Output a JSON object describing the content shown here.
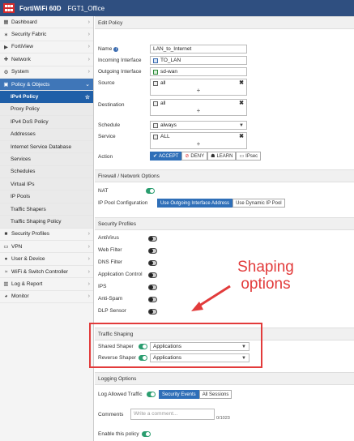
{
  "header": {
    "device": "FortiWiFi 60D",
    "hostname": "FGT1_Office"
  },
  "sidebar": {
    "items": [
      {
        "label": "Dashboard",
        "icon": "dashboard-icon",
        "glyph": "▦"
      },
      {
        "label": "Security Fabric",
        "icon": "fabric-icon",
        "glyph": "✶"
      },
      {
        "label": "FortiView",
        "icon": "fortiview-icon",
        "glyph": "▶"
      },
      {
        "label": "Network",
        "icon": "network-icon",
        "glyph": "✚"
      },
      {
        "label": "System",
        "icon": "system-icon",
        "glyph": "⚙"
      },
      {
        "label": "Policy & Objects",
        "icon": "policy-icon",
        "glyph": "▣"
      }
    ],
    "subitems": [
      "IPv4 Policy",
      "Proxy Policy",
      "IPv4 DoS Policy",
      "Addresses",
      "Internet Service Database",
      "Services",
      "Schedules",
      "Virtual IPs",
      "IP Pools",
      "Traffic Shapers",
      "Traffic Shaping Policy"
    ],
    "items2": [
      {
        "label": "Security Profiles",
        "icon": "lock-icon",
        "glyph": "■"
      },
      {
        "label": "VPN",
        "icon": "vpn-icon",
        "glyph": "▭"
      },
      {
        "label": "User & Device",
        "icon": "user-icon",
        "glyph": "●"
      },
      {
        "label": "WiFi & Switch Controller",
        "icon": "wifi-icon",
        "glyph": "≈"
      },
      {
        "label": "Log & Report",
        "icon": "chart-icon",
        "glyph": "▥"
      },
      {
        "label": "Monitor",
        "icon": "monitor-icon",
        "glyph": "◕"
      }
    ]
  },
  "page": {
    "title": "Edit Policy"
  },
  "form": {
    "name_label": "Name",
    "name_value": "LAN_to_Internet",
    "in_label": "Incoming Interface",
    "in_value": "TO_LAN",
    "out_label": "Outgoing Interface",
    "out_value": "sd-wan",
    "src_label": "Source",
    "src_value": "all",
    "dst_label": "Destination",
    "dst_value": "all",
    "sched_label": "Schedule",
    "sched_value": "always",
    "svc_label": "Service",
    "svc_value": "ALL",
    "action_label": "Action",
    "actions": [
      "ACCEPT",
      "DENY",
      "LEARN",
      "IPsec"
    ]
  },
  "firewall": {
    "header": "Firewall / Network Options",
    "nat_label": "NAT",
    "ippool_label": "IP Pool Configuration",
    "ippool_opt1": "Use Outgoing Interface Address",
    "ippool_opt2": "Use Dynamic IP Pool"
  },
  "profiles": {
    "header": "Security Profiles",
    "items": [
      "AntiVirus",
      "Web Filter",
      "DNS Filter",
      "Application Control",
      "IPS",
      "Anti-Spam",
      "DLP Sensor"
    ]
  },
  "shaping": {
    "header": "Traffic Shaping",
    "shared_label": "Shared Shaper",
    "shared_value": "Applications",
    "reverse_label": "Reverse Shaper",
    "reverse_value": "Applications"
  },
  "logging": {
    "header": "Logging Options",
    "log_label": "Log Allowed Traffic",
    "opt1": "Security Events",
    "opt2": "All Sessions",
    "comments_label": "Comments",
    "comments_placeholder": "Write a comment...",
    "comments_count": "0/1023",
    "enable_label": "Enable this policy"
  },
  "annotation": {
    "line1": "Shaping",
    "line2": "options",
    "color": "#e23b3b"
  }
}
